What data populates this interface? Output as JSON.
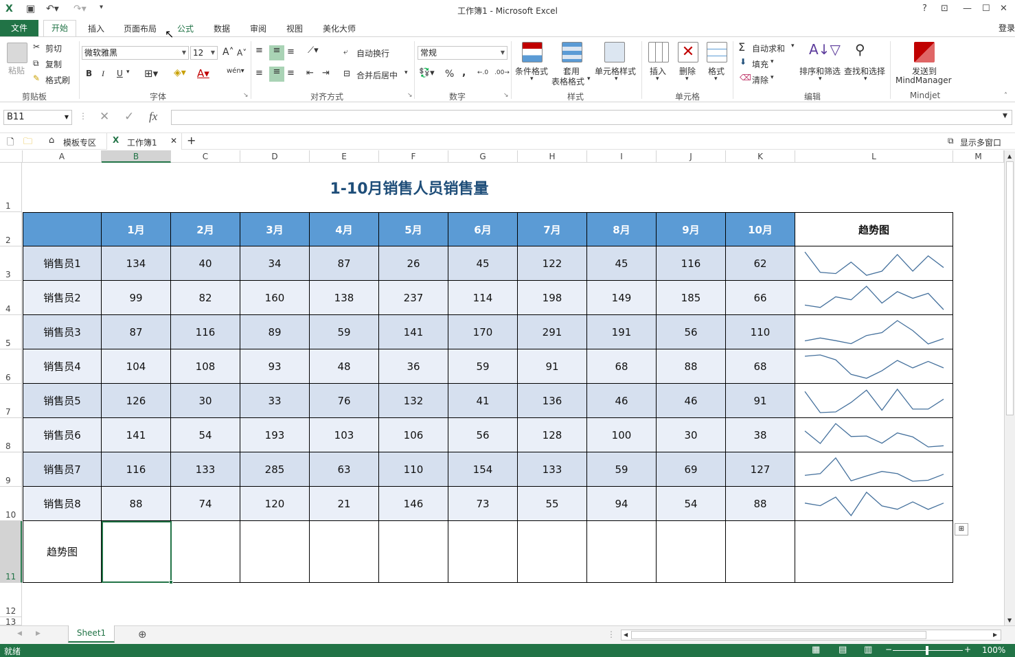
{
  "window": {
    "title": "工作簿1 - Microsoft Excel",
    "help": "?",
    "login": "登录"
  },
  "tabs": [
    "文件",
    "开始",
    "插入",
    "页面布局",
    "公式",
    "数据",
    "审阅",
    "视图",
    "美化大师"
  ],
  "ribbon": {
    "clipboard": {
      "paste": "粘贴",
      "cut": "剪切",
      "copy": "复制",
      "format_painter": "格式刷",
      "label": "剪贴板"
    },
    "font": {
      "name": "微软雅黑",
      "size": "12",
      "bold": "B",
      "italic": "I",
      "underline": "U",
      "label": "字体"
    },
    "alignment": {
      "wrap": "自动换行",
      "merge": "合并后居中",
      "label": "对齐方式"
    },
    "number": {
      "format": "常规",
      "percent": "%",
      "comma": ",",
      "label": "数字"
    },
    "styles": {
      "conditional": "条件格式",
      "table_line1": "套用",
      "table_line2": "表格格式",
      "cell_styles": "单元格样式",
      "label": "样式"
    },
    "cells": {
      "insert": "插入",
      "delete": "删除",
      "format": "格式",
      "label": "单元格"
    },
    "editing": {
      "autosum": "自动求和",
      "fill": "填充",
      "clear": "清除",
      "sort": "排序和筛选",
      "find": "查找和选择",
      "label": "编辑"
    },
    "mindjet": {
      "send_line1": "发送到",
      "send_line2": "MindManager",
      "label": "Mindjet"
    }
  },
  "formula_bar": {
    "name_box": "B11",
    "fx": "fx",
    "value": ""
  },
  "workbook_tabs": {
    "templates": "模板专区",
    "workbook": "工作簿1",
    "add": "+",
    "multi_window": "显示多窗口"
  },
  "columns": [
    "A",
    "B",
    "C",
    "D",
    "E",
    "F",
    "G",
    "H",
    "I",
    "J",
    "K",
    "L",
    "M"
  ],
  "rows": [
    "1",
    "2",
    "3",
    "4",
    "5",
    "6",
    "7",
    "8",
    "9",
    "10",
    "11",
    "12",
    "13"
  ],
  "sheet": {
    "title": "1-10月销售人员销售量",
    "months": [
      "1月",
      "2月",
      "3月",
      "4月",
      "5月",
      "6月",
      "7月",
      "8月",
      "9月",
      "10月"
    ],
    "trend_header": "趋势图",
    "trend_row_label": "趋势图",
    "sales": [
      {
        "name": "销售员1",
        "values": [
          134,
          40,
          34,
          87,
          26,
          45,
          122,
          45,
          116,
          62
        ]
      },
      {
        "name": "销售员2",
        "values": [
          99,
          82,
          160,
          138,
          237,
          114,
          198,
          149,
          185,
          66
        ]
      },
      {
        "name": "销售员3",
        "values": [
          87,
          116,
          89,
          59,
          141,
          170,
          291,
          191,
          56,
          110
        ]
      },
      {
        "name": "销售员4",
        "values": [
          104,
          108,
          93,
          48,
          36,
          59,
          91,
          68,
          88,
          68
        ]
      },
      {
        "name": "销售员5",
        "values": [
          126,
          30,
          33,
          76,
          132,
          41,
          136,
          46,
          46,
          91
        ]
      },
      {
        "name": "销售员6",
        "values": [
          141,
          54,
          193,
          103,
          106,
          56,
          128,
          100,
          30,
          38
        ]
      },
      {
        "name": "销售员7",
        "values": [
          116,
          133,
          285,
          63,
          110,
          154,
          133,
          59,
          69,
          127
        ]
      },
      {
        "name": "销售员8",
        "values": [
          88,
          74,
          120,
          21,
          146,
          73,
          55,
          94,
          54,
          88
        ]
      }
    ],
    "sparkline_color": "#44709c",
    "header_color": "#5b9bd5"
  },
  "sheet_tabs": {
    "active": "Sheet1"
  },
  "status": {
    "ready": "就绪",
    "zoom": "100%"
  }
}
